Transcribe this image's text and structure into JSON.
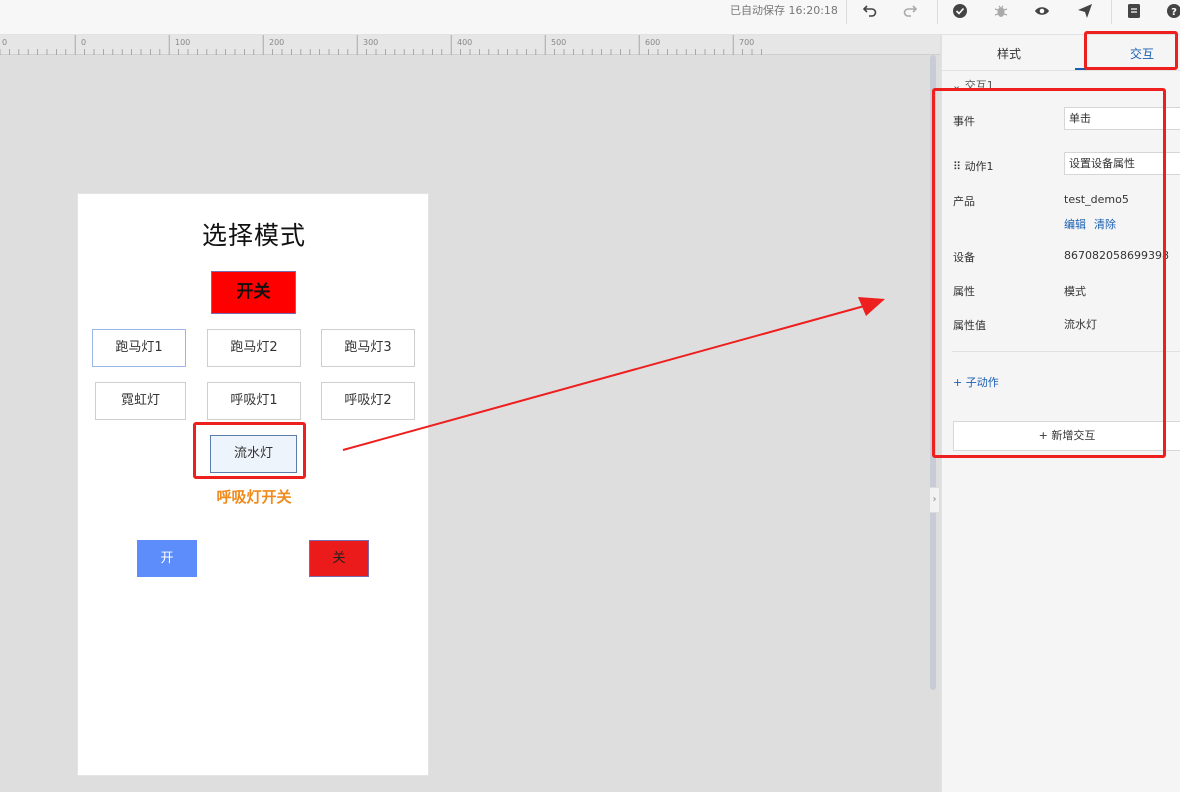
{
  "toolbar": {
    "autosave_text": "已自动保存 16:20:18",
    "icons": [
      "undo-icon",
      "redo-icon",
      "check-icon",
      "bug-icon",
      "eye-icon",
      "send-icon",
      "document-icon",
      "help-icon"
    ]
  },
  "ruler": {
    "ticks": [
      "0",
      "0",
      "100",
      "200",
      "300",
      "400",
      "500",
      "600",
      "700"
    ]
  },
  "phone": {
    "title": "选择模式",
    "switch_label": "开关",
    "modes": [
      "跑马灯1",
      "跑马灯2",
      "跑马灯3",
      "霓虹灯",
      "呼吸灯1",
      "呼吸灯2"
    ],
    "flow_label": "流水灯",
    "breath_switch_label": "呼吸灯开关",
    "on_label": "开",
    "off_label": "关"
  },
  "panel": {
    "tabs": [
      "样式",
      "交互"
    ],
    "active_tab": "交互",
    "section_title": "交互1",
    "event_label": "事件",
    "event_value": "单击",
    "action_label": "动作1",
    "action_value": "设置设备属性",
    "product_label": "产品",
    "product_value": "test_demo5",
    "edit_link": "编辑",
    "clear_link": "清除",
    "device_label": "设备",
    "device_value": "867082058699398",
    "property_label": "属性",
    "property_value": "模式",
    "property_value_label": "属性值",
    "property_value_value": "流水灯",
    "sub_action_link": "+ 子动作",
    "add_interaction_label": "+ 新增交互"
  },
  "colors": {
    "annotation_red": "#ee1f1f",
    "accent_blue": "#1a5fb4",
    "switch_red": "#ff0000",
    "on_blue": "#5c8dfb",
    "label_orange": "#f08a1c"
  }
}
